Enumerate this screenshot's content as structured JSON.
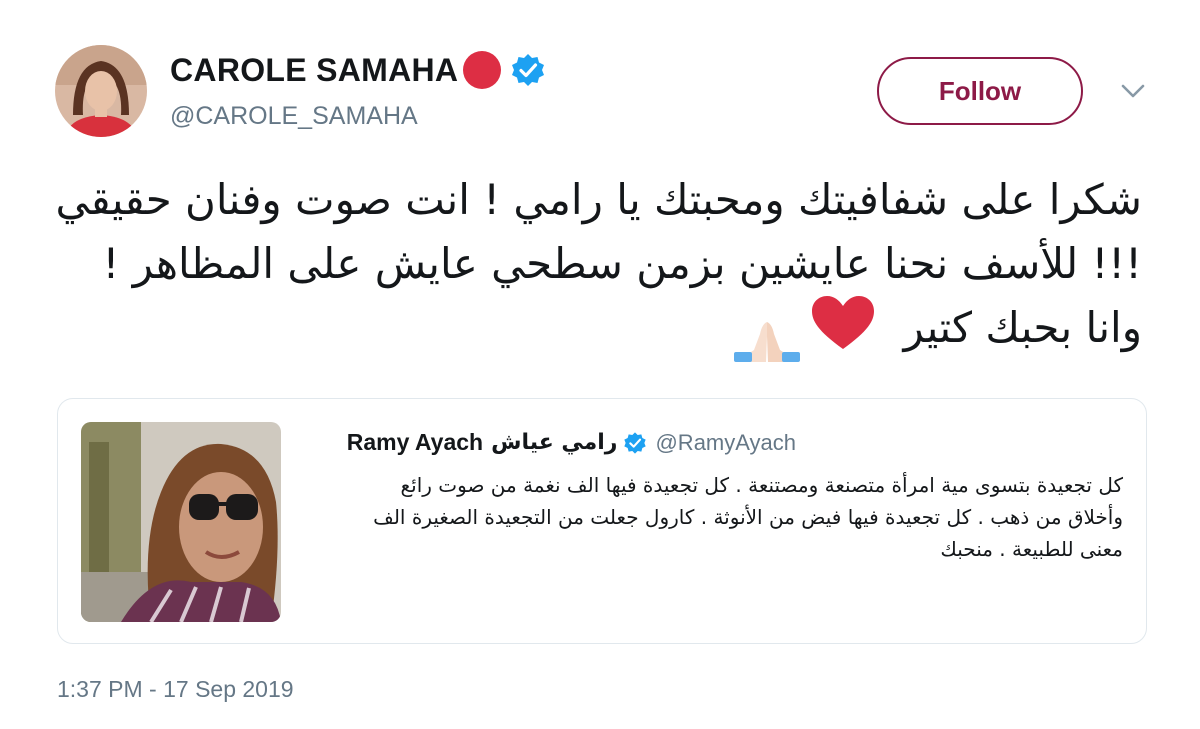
{
  "author": {
    "name": "CAROLE SAMAHA",
    "handle": "@CAROLE_SAMAHA"
  },
  "follow_button": {
    "label": "Follow"
  },
  "tweet": {
    "lines": [
      "شكرا على شفافيتك ومحبتك يا رامي ! انت صوت وفنان حقيقي",
      "!!! للأسف نحنا عايشين بزمن سطحي عايش على المظاهر !",
      "وانا بحبك كتير"
    ]
  },
  "quoted_tweet": {
    "name": "Ramy Ayach",
    "name_arabic": "رامي عياش",
    "handle": "@RamyAyach",
    "lines": [
      "كل تجعيدة بتسوى مية امرأة متصنعة ومصتنعة . كل تجعيدة فيها الف نغمة من صوت رائع",
      "وأخلاق من ذهب . كل تجعيدة فيها فيض من الأنوثة . كارول جعلت من التجعيدة الصغيرة الف",
      "معنى للطبيعة . منحبك"
    ]
  },
  "timestamp": "1:37 PM - 17 Sep 2019",
  "icons": {
    "verified": "verified-badge-icon",
    "status": "red-circle-emoji",
    "chevron": "chevron-down-icon",
    "heart": "red-heart-emoji",
    "hands": "folded-hands-emoji"
  },
  "colors": {
    "follow_accent": "#8d1a47",
    "verified_blue": "#1da1f2",
    "secondary_text": "#657786",
    "border": "#e1e8ed"
  }
}
